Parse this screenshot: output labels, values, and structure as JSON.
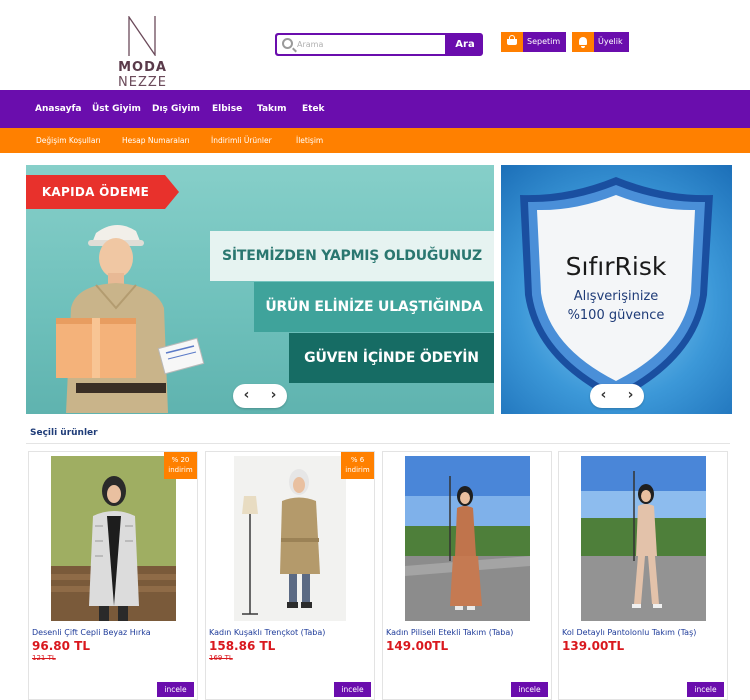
{
  "brand": {
    "logo_word1": "MODA",
    "logo_word2": "NEZZE"
  },
  "search": {
    "placeholder": "Arama",
    "button": "Ara"
  },
  "header_buttons": {
    "cart": "Sepetim",
    "member": "Üyelik"
  },
  "nav": [
    "Anasayfa",
    "Üst Giyim",
    "Dış Giyim",
    "Elbise",
    "Takım",
    "Etek"
  ],
  "subnav": [
    "Değişim Koşulları",
    "Hesap Numaraları",
    "İndirimli Ürünler",
    "İletişim"
  ],
  "banner1": {
    "badge": "KAPIDA ÖDEME",
    "line1": "SİTEMİZDEN YAPMIŞ OLDUĞUNUZ",
    "line2": "ÜRÜN ELİNİZE ULAŞTIĞINDA",
    "line3": "GÜVEN İÇİNDE ÖDEYİN"
  },
  "banner2": {
    "title": "SıfırRisk",
    "line1": "Alışverişinize",
    "line2": "%100 güvence"
  },
  "slider": {
    "prev": "‹",
    "next": "›"
  },
  "section_title": "Seçili ürünler",
  "products": [
    {
      "name": "Desenli Çift Cepli Beyaz Hırka",
      "price": "96.80 TL",
      "old_price": "121 TL",
      "discount_pct": "% 20",
      "discount_word": "indirim",
      "button": "incele"
    },
    {
      "name": "Kadın Kuşaklı Trençkot (Taba)",
      "price": "158.86 TL",
      "old_price": "169 TL",
      "discount_pct": "% 6",
      "discount_word": "indirim",
      "button": "incele"
    },
    {
      "name": "Kadın Piliseli Etekli Takım (Taba)",
      "price": "149.00TL",
      "button": "incele"
    },
    {
      "name": "Kol Detaylı Pantolonlu Takım (Taş)",
      "price": "139.00TL",
      "button": "incele"
    }
  ],
  "colors": {
    "purple": "#6a0dad",
    "orange": "#ff8000",
    "price_red": "#d9181e"
  }
}
